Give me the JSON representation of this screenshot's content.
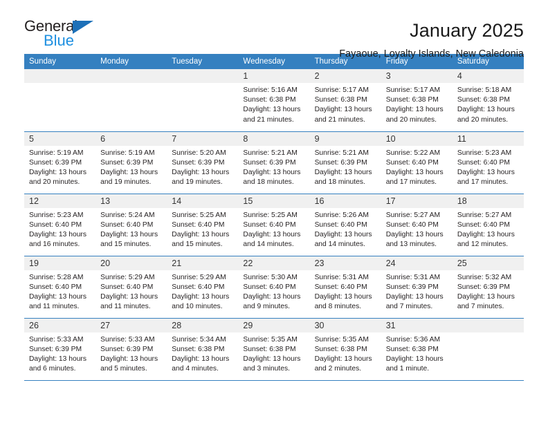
{
  "brand": {
    "name_part1": "General",
    "name_part2": "Blue",
    "accent_color": "#1d70b8",
    "blue_color": "#1d8fe0"
  },
  "header": {
    "title": "January 2025",
    "subtitle": "Fayaoue, Loyalty Islands, New Caledonia"
  },
  "calendar": {
    "header_bg": "#3580c0",
    "daynum_bg": "#f0f0f0",
    "weekdays": [
      "Sunday",
      "Monday",
      "Tuesday",
      "Wednesday",
      "Thursday",
      "Friday",
      "Saturday"
    ],
    "weeks": [
      [
        {
          "day": "",
          "empty": true
        },
        {
          "day": "",
          "empty": true
        },
        {
          "day": "",
          "empty": true
        },
        {
          "day": "1",
          "sunrise": "Sunrise: 5:16 AM",
          "sunset": "Sunset: 6:38 PM",
          "daylight": "Daylight: 13 hours and 21 minutes."
        },
        {
          "day": "2",
          "sunrise": "Sunrise: 5:17 AM",
          "sunset": "Sunset: 6:38 PM",
          "daylight": "Daylight: 13 hours and 21 minutes."
        },
        {
          "day": "3",
          "sunrise": "Sunrise: 5:17 AM",
          "sunset": "Sunset: 6:38 PM",
          "daylight": "Daylight: 13 hours and 20 minutes."
        },
        {
          "day": "4",
          "sunrise": "Sunrise: 5:18 AM",
          "sunset": "Sunset: 6:38 PM",
          "daylight": "Daylight: 13 hours and 20 minutes."
        }
      ],
      [
        {
          "day": "5",
          "sunrise": "Sunrise: 5:19 AM",
          "sunset": "Sunset: 6:39 PM",
          "daylight": "Daylight: 13 hours and 20 minutes."
        },
        {
          "day": "6",
          "sunrise": "Sunrise: 5:19 AM",
          "sunset": "Sunset: 6:39 PM",
          "daylight": "Daylight: 13 hours and 19 minutes."
        },
        {
          "day": "7",
          "sunrise": "Sunrise: 5:20 AM",
          "sunset": "Sunset: 6:39 PM",
          "daylight": "Daylight: 13 hours and 19 minutes."
        },
        {
          "day": "8",
          "sunrise": "Sunrise: 5:21 AM",
          "sunset": "Sunset: 6:39 PM",
          "daylight": "Daylight: 13 hours and 18 minutes."
        },
        {
          "day": "9",
          "sunrise": "Sunrise: 5:21 AM",
          "sunset": "Sunset: 6:39 PM",
          "daylight": "Daylight: 13 hours and 18 minutes."
        },
        {
          "day": "10",
          "sunrise": "Sunrise: 5:22 AM",
          "sunset": "Sunset: 6:40 PM",
          "daylight": "Daylight: 13 hours and 17 minutes."
        },
        {
          "day": "11",
          "sunrise": "Sunrise: 5:23 AM",
          "sunset": "Sunset: 6:40 PM",
          "daylight": "Daylight: 13 hours and 17 minutes."
        }
      ],
      [
        {
          "day": "12",
          "sunrise": "Sunrise: 5:23 AM",
          "sunset": "Sunset: 6:40 PM",
          "daylight": "Daylight: 13 hours and 16 minutes."
        },
        {
          "day": "13",
          "sunrise": "Sunrise: 5:24 AM",
          "sunset": "Sunset: 6:40 PM",
          "daylight": "Daylight: 13 hours and 15 minutes."
        },
        {
          "day": "14",
          "sunrise": "Sunrise: 5:25 AM",
          "sunset": "Sunset: 6:40 PM",
          "daylight": "Daylight: 13 hours and 15 minutes."
        },
        {
          "day": "15",
          "sunrise": "Sunrise: 5:25 AM",
          "sunset": "Sunset: 6:40 PM",
          "daylight": "Daylight: 13 hours and 14 minutes."
        },
        {
          "day": "16",
          "sunrise": "Sunrise: 5:26 AM",
          "sunset": "Sunset: 6:40 PM",
          "daylight": "Daylight: 13 hours and 14 minutes."
        },
        {
          "day": "17",
          "sunrise": "Sunrise: 5:27 AM",
          "sunset": "Sunset: 6:40 PM",
          "daylight": "Daylight: 13 hours and 13 minutes."
        },
        {
          "day": "18",
          "sunrise": "Sunrise: 5:27 AM",
          "sunset": "Sunset: 6:40 PM",
          "daylight": "Daylight: 13 hours and 12 minutes."
        }
      ],
      [
        {
          "day": "19",
          "sunrise": "Sunrise: 5:28 AM",
          "sunset": "Sunset: 6:40 PM",
          "daylight": "Daylight: 13 hours and 11 minutes."
        },
        {
          "day": "20",
          "sunrise": "Sunrise: 5:29 AM",
          "sunset": "Sunset: 6:40 PM",
          "daylight": "Daylight: 13 hours and 11 minutes."
        },
        {
          "day": "21",
          "sunrise": "Sunrise: 5:29 AM",
          "sunset": "Sunset: 6:40 PM",
          "daylight": "Daylight: 13 hours and 10 minutes."
        },
        {
          "day": "22",
          "sunrise": "Sunrise: 5:30 AM",
          "sunset": "Sunset: 6:40 PM",
          "daylight": "Daylight: 13 hours and 9 minutes."
        },
        {
          "day": "23",
          "sunrise": "Sunrise: 5:31 AM",
          "sunset": "Sunset: 6:40 PM",
          "daylight": "Daylight: 13 hours and 8 minutes."
        },
        {
          "day": "24",
          "sunrise": "Sunrise: 5:31 AM",
          "sunset": "Sunset: 6:39 PM",
          "daylight": "Daylight: 13 hours and 7 minutes."
        },
        {
          "day": "25",
          "sunrise": "Sunrise: 5:32 AM",
          "sunset": "Sunset: 6:39 PM",
          "daylight": "Daylight: 13 hours and 7 minutes."
        }
      ],
      [
        {
          "day": "26",
          "sunrise": "Sunrise: 5:33 AM",
          "sunset": "Sunset: 6:39 PM",
          "daylight": "Daylight: 13 hours and 6 minutes."
        },
        {
          "day": "27",
          "sunrise": "Sunrise: 5:33 AM",
          "sunset": "Sunset: 6:39 PM",
          "daylight": "Daylight: 13 hours and 5 minutes."
        },
        {
          "day": "28",
          "sunrise": "Sunrise: 5:34 AM",
          "sunset": "Sunset: 6:38 PM",
          "daylight": "Daylight: 13 hours and 4 minutes."
        },
        {
          "day": "29",
          "sunrise": "Sunrise: 5:35 AM",
          "sunset": "Sunset: 6:38 PM",
          "daylight": "Daylight: 13 hours and 3 minutes."
        },
        {
          "day": "30",
          "sunrise": "Sunrise: 5:35 AM",
          "sunset": "Sunset: 6:38 PM",
          "daylight": "Daylight: 13 hours and 2 minutes."
        },
        {
          "day": "31",
          "sunrise": "Sunrise: 5:36 AM",
          "sunset": "Sunset: 6:38 PM",
          "daylight": "Daylight: 13 hours and 1 minute."
        },
        {
          "day": "",
          "empty": true
        }
      ]
    ]
  }
}
